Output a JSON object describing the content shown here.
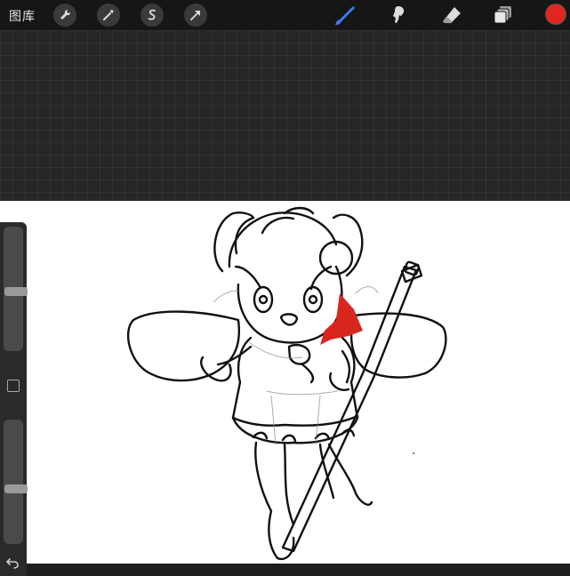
{
  "toolbar": {
    "gallery_label": "图库",
    "actions_icon": "wrench-icon",
    "adjustments_icon": "magic-wand-icon",
    "selection_icon": "selection-s-icon",
    "transform_icon": "arrow-icon",
    "brush_icon": "brush-icon",
    "smudge_icon": "smudge-icon",
    "eraser_icon": "eraser-icon",
    "layers_icon": "layers-icon",
    "current_color": "#e0261f",
    "active_tool_color": "#3a7bff"
  },
  "sidebar": {
    "brush_size_level": 0.48,
    "opacity_level": 0.44
  },
  "canvas": {
    "fill_color": "#d8261e"
  }
}
